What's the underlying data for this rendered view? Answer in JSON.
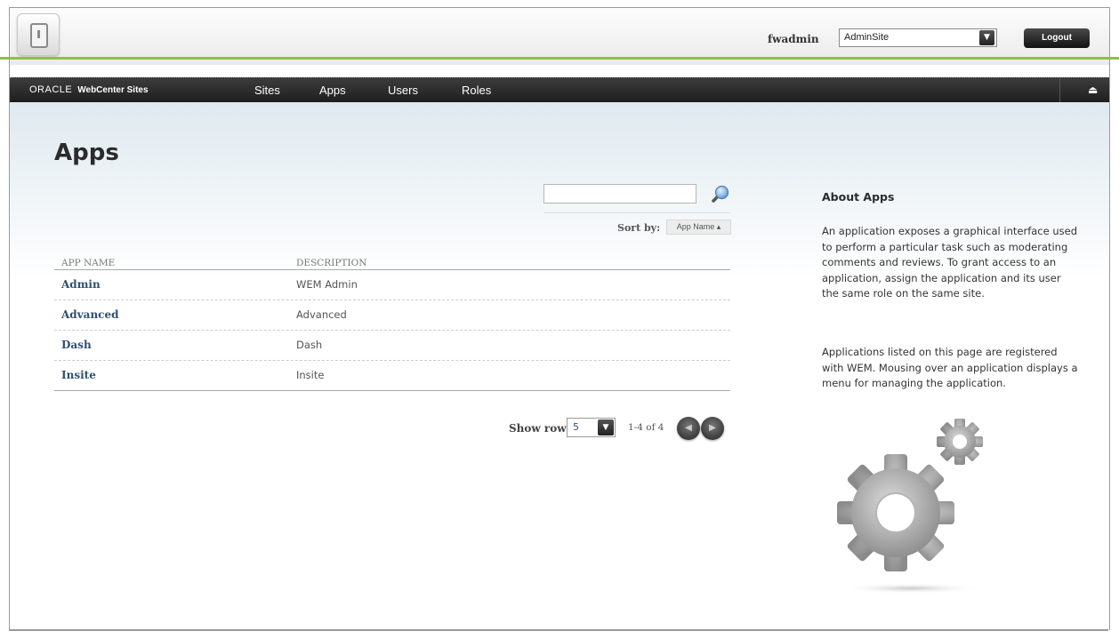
{
  "header": {
    "username": "fwadmin",
    "site_select": {
      "value": "AdminSite"
    },
    "logout_label": "Logout"
  },
  "nav": {
    "brand": "ORACLE",
    "product": "WebCenter Sites",
    "items": [
      {
        "label": "Sites"
      },
      {
        "label": "Apps"
      },
      {
        "label": "Users"
      },
      {
        "label": "Roles"
      }
    ]
  },
  "page": {
    "title": "Apps",
    "search": {
      "value": "",
      "placeholder": ""
    },
    "sort_label": "Sort by:",
    "sort_value": "App Name",
    "table": {
      "columns": [
        "APP NAME",
        "DESCRIPTION"
      ],
      "rows": [
        {
          "name": "Admin",
          "description": "WEM Admin"
        },
        {
          "name": "Advanced",
          "description": "Advanced"
        },
        {
          "name": "Dash",
          "description": "Dash"
        },
        {
          "name": "Insite",
          "description": "Insite"
        }
      ]
    },
    "pagination": {
      "show_rows_label": "Show rows:",
      "rows_value": "5",
      "range": "1-4 of 4"
    }
  },
  "sidebar": {
    "title": "About Apps",
    "paragraphs": [
      "An application exposes a graphical interface used to perform a particular task such as moderating comments and reviews. To grant access to an application, assign the application and its user the same role on the same site.",
      "Applications listed on this page are registered with WEM. Mousing over an application displays a menu for managing the application."
    ]
  },
  "icons": {
    "app_launcher": "app-launcher-icon",
    "dropdown": "chevron-down-icon",
    "eject": "eject-icon",
    "search": "search-icon",
    "prev": "prev-page-icon",
    "next": "next-page-icon",
    "gears": "gears-icon"
  },
  "colors": {
    "accent_green": "#8ec03f",
    "navbar": "#262626",
    "link_blue": "#2f5070"
  }
}
